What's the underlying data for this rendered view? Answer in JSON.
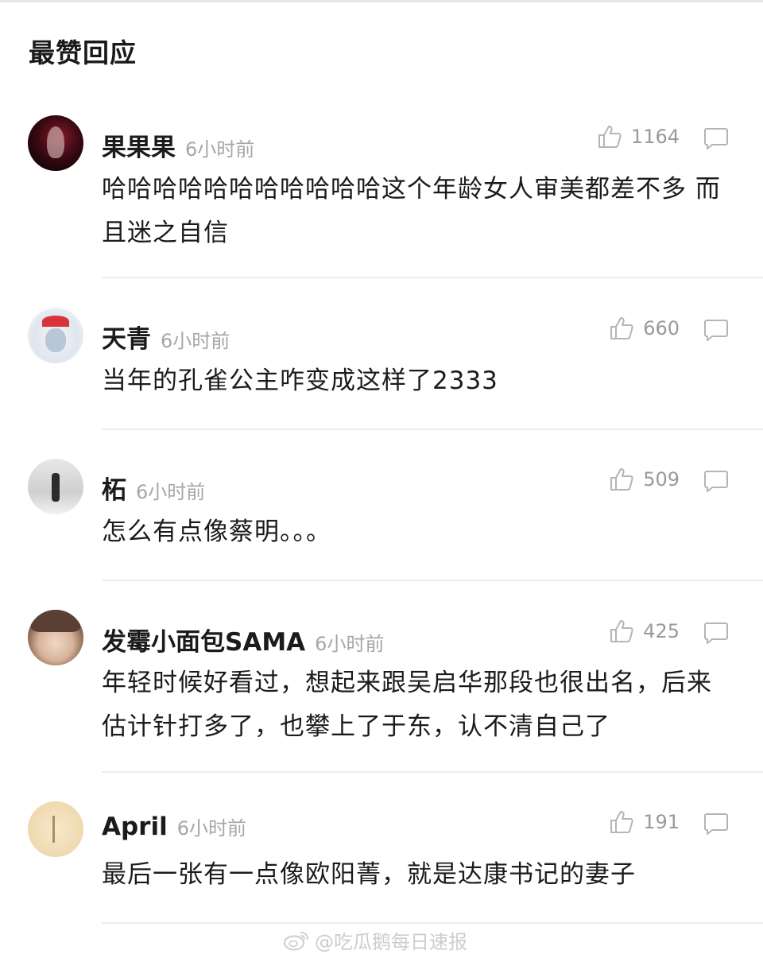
{
  "section_title": "最赞回应",
  "comments": [
    {
      "username": "果果果",
      "time": "6小时前",
      "likes": "1164",
      "text": "哈哈哈哈哈哈哈哈哈哈哈这个年龄女人审美都差不多 而且迷之自信"
    },
    {
      "username": "天青",
      "time": "6小时前",
      "likes": "660",
      "text": "当年的孔雀公主咋变成这样了2333"
    },
    {
      "username": "柘",
      "time": "6小时前",
      "likes": "509",
      "text": "怎么有点像蔡明。。。"
    },
    {
      "username": "发霉小面包SAMA",
      "time": "6小时前",
      "likes": "425",
      "text": "年轻时候好看过，想起来跟吴启华那段也很出名，后来估计针打多了，也攀上了于东，认不清自己了"
    },
    {
      "username": "April",
      "time": "6小时前",
      "likes": "191",
      "text": "最后一张有一点像欧阳菁，就是达康书记的妻子"
    }
  ],
  "watermark": "@吃瓜鹅每日速报",
  "icons": {
    "like": "thumbs-up-icon",
    "reply": "comment-bubble-icon",
    "watermark": "weibo-logo-icon"
  },
  "colors": {
    "background": "#ffffff",
    "text": "#1b1b1b",
    "meta": "#a6a6a6",
    "divider": "#ececec"
  }
}
